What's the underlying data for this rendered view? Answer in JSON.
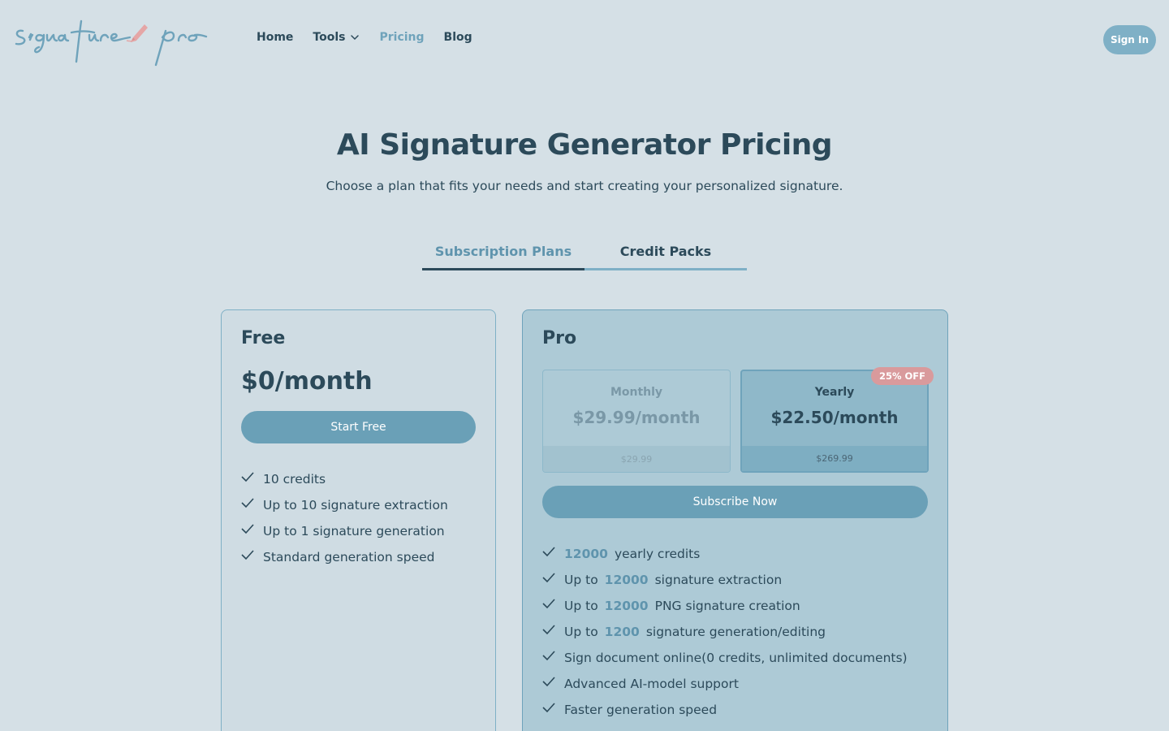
{
  "header": {
    "logo_text": "signature pro",
    "nav": [
      {
        "label": "Home"
      },
      {
        "label": "Tools"
      },
      {
        "label": "Pricing"
      },
      {
        "label": "Blog"
      }
    ],
    "signin_label": "Sign In"
  },
  "hero": {
    "title": "AI Signature Generator Pricing",
    "subtitle": "Choose a plan that fits your needs and start creating your personalized signature."
  },
  "tabs": [
    {
      "label": "Subscription Plans",
      "active": true
    },
    {
      "label": "Credit Packs",
      "active": false
    }
  ],
  "plans": {
    "free": {
      "name": "Free",
      "price": "$0/month",
      "button": "Start Free",
      "features": [
        "10 credits",
        "Up to 10 signature extraction",
        "Up to 1 signature generation",
        "Standard generation speed"
      ]
    },
    "pro": {
      "name": "Pro",
      "monthly": {
        "label": "Monthly",
        "price": "$29.99/month",
        "total": "$29.99"
      },
      "yearly": {
        "label": "Yearly",
        "price": "$22.50/month",
        "total": "$269.99",
        "badge": "25% OFF",
        "selected": true
      },
      "button": "Subscribe Now",
      "features": [
        {
          "pre": "",
          "hl": "12000",
          "post": "yearly credits"
        },
        {
          "pre": "Up to",
          "hl": "12000",
          "post": "signature extraction"
        },
        {
          "pre": "Up to",
          "hl": "12000",
          "post": "PNG signature creation"
        },
        {
          "pre": "Up to",
          "hl": "1200",
          "post": "signature generation/editing"
        },
        {
          "pre": "Sign document online(0 credits, unlimited documents)",
          "hl": "",
          "post": ""
        },
        {
          "pre": "Advanced AI-model support",
          "hl": "",
          "post": ""
        },
        {
          "pre": "Faster generation speed",
          "hl": "",
          "post": ""
        }
      ]
    }
  },
  "colors": {
    "background": "#d5e0e6",
    "accent": "#6aa0b7",
    "text": "#2c4a5a",
    "badge": "#d99a9c"
  }
}
